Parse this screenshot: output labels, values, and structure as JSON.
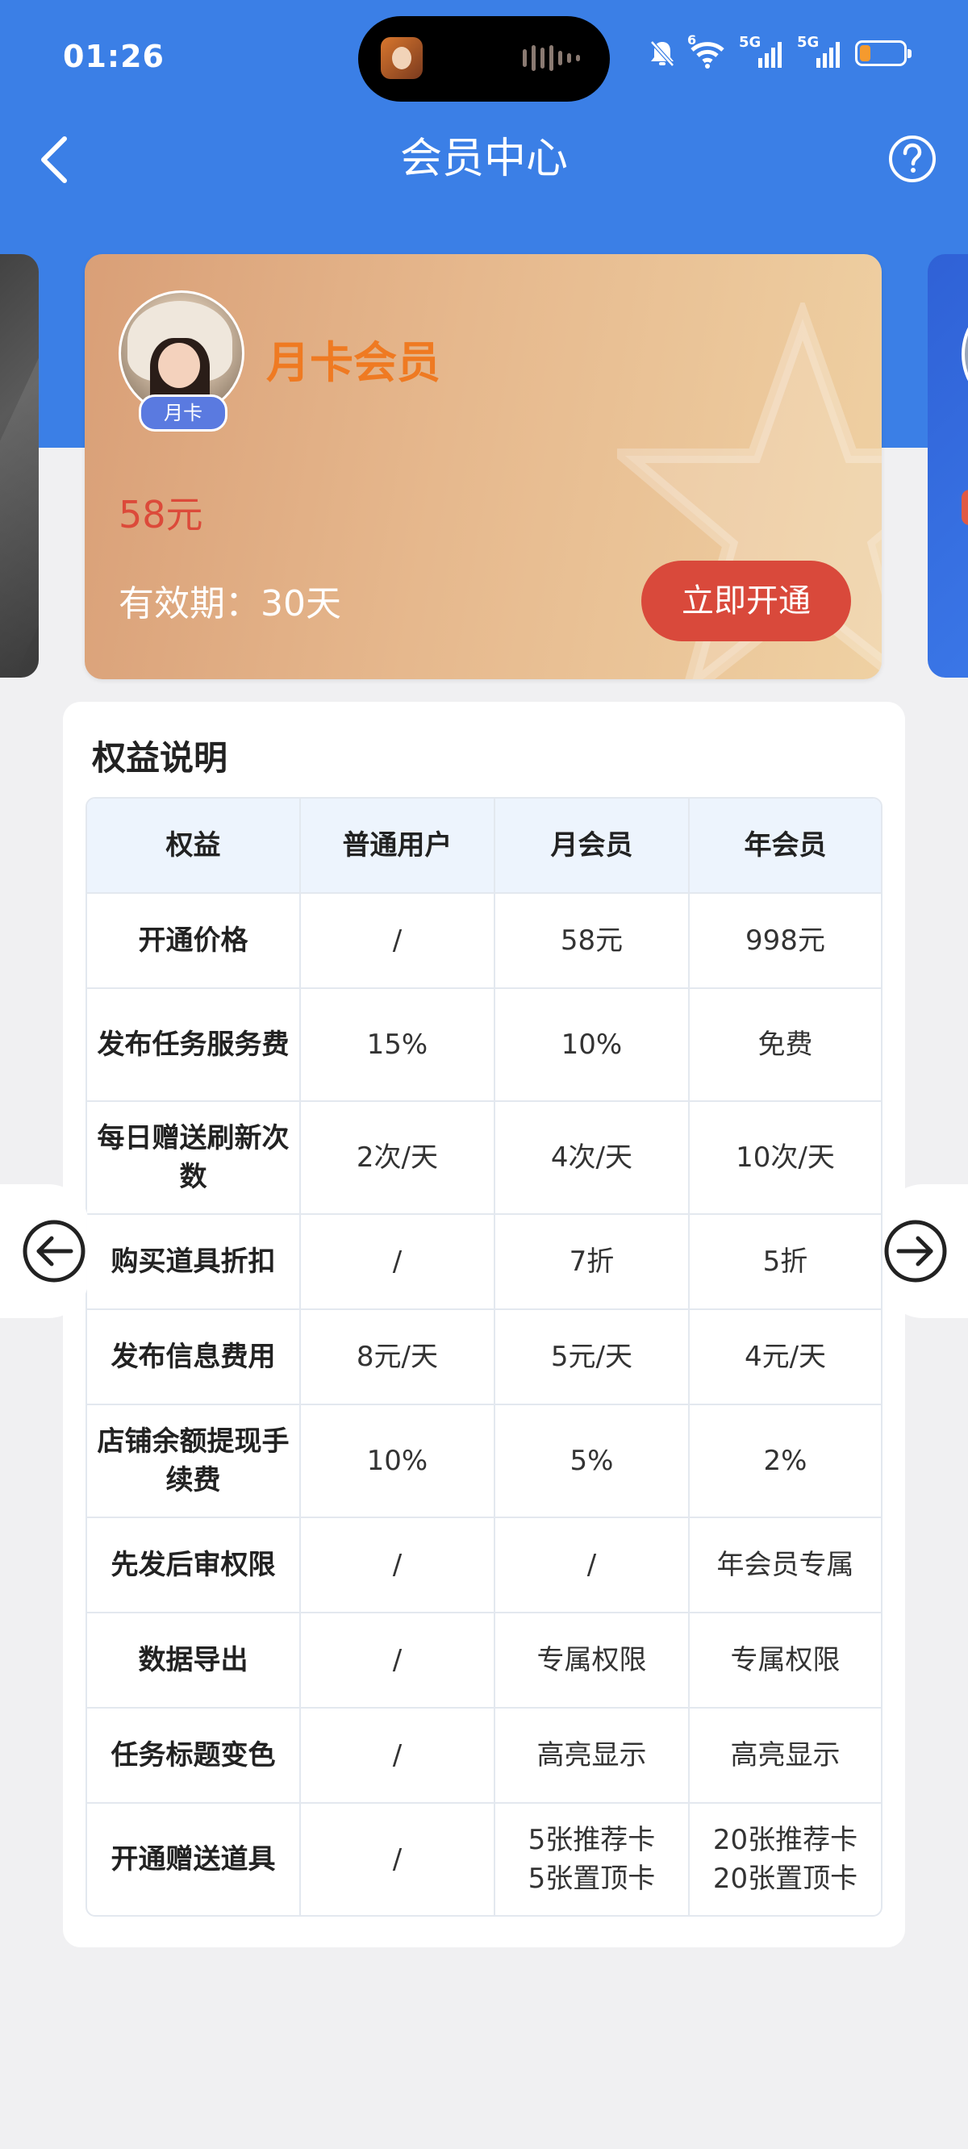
{
  "status_bar": {
    "time": "01:26",
    "net1": "5G",
    "net2": "5G",
    "wifi_tag": "6",
    "battery_level": 0.25
  },
  "nav": {
    "title": "会员中心"
  },
  "card": {
    "badge": "月卡",
    "title": "月卡会员",
    "price": "58元",
    "validity": "有效期：30天",
    "button": "立即开通",
    "title_color": "#ef7a22",
    "button_color": "#d9493b"
  },
  "benefits": {
    "title": "权益说明",
    "headers": [
      "权益",
      "普通用户",
      "月会员",
      "年会员"
    ],
    "rows": [
      [
        "开通价格",
        "/",
        "58元",
        "998元"
      ],
      [
        "发布任务服务费",
        "15%",
        "10%",
        "免费"
      ],
      [
        "每日赠送刷新次数",
        "2次/天",
        "4次/天",
        "10次/天"
      ],
      [
        "购买道具折扣",
        "/",
        "7折",
        "5折"
      ],
      [
        "发布信息费用",
        "8元/天",
        "5元/天",
        "4元/天"
      ],
      [
        "店铺余额提现手续费",
        "10%",
        "5%",
        "2%"
      ],
      [
        "先发后审权限",
        "/",
        "/",
        "年会员专属"
      ],
      [
        "数据导出",
        "/",
        "专属权限",
        "专属权限"
      ],
      [
        "任务标题变色",
        "/",
        "高亮显示",
        "高亮显示"
      ],
      [
        "开通赠送道具",
        "/",
        "5张推荐卡\n5张置顶卡",
        "20张推荐卡\n20张置顶卡"
      ]
    ]
  },
  "icons": {
    "back": "chevron-left-icon",
    "help": "question-circle-icon",
    "prev": "arrow-left-circle-icon",
    "next": "arrow-right-circle-icon"
  },
  "colors": {
    "header_bg": "#3b7fe6",
    "table_header_bg": "#edf4fd"
  }
}
